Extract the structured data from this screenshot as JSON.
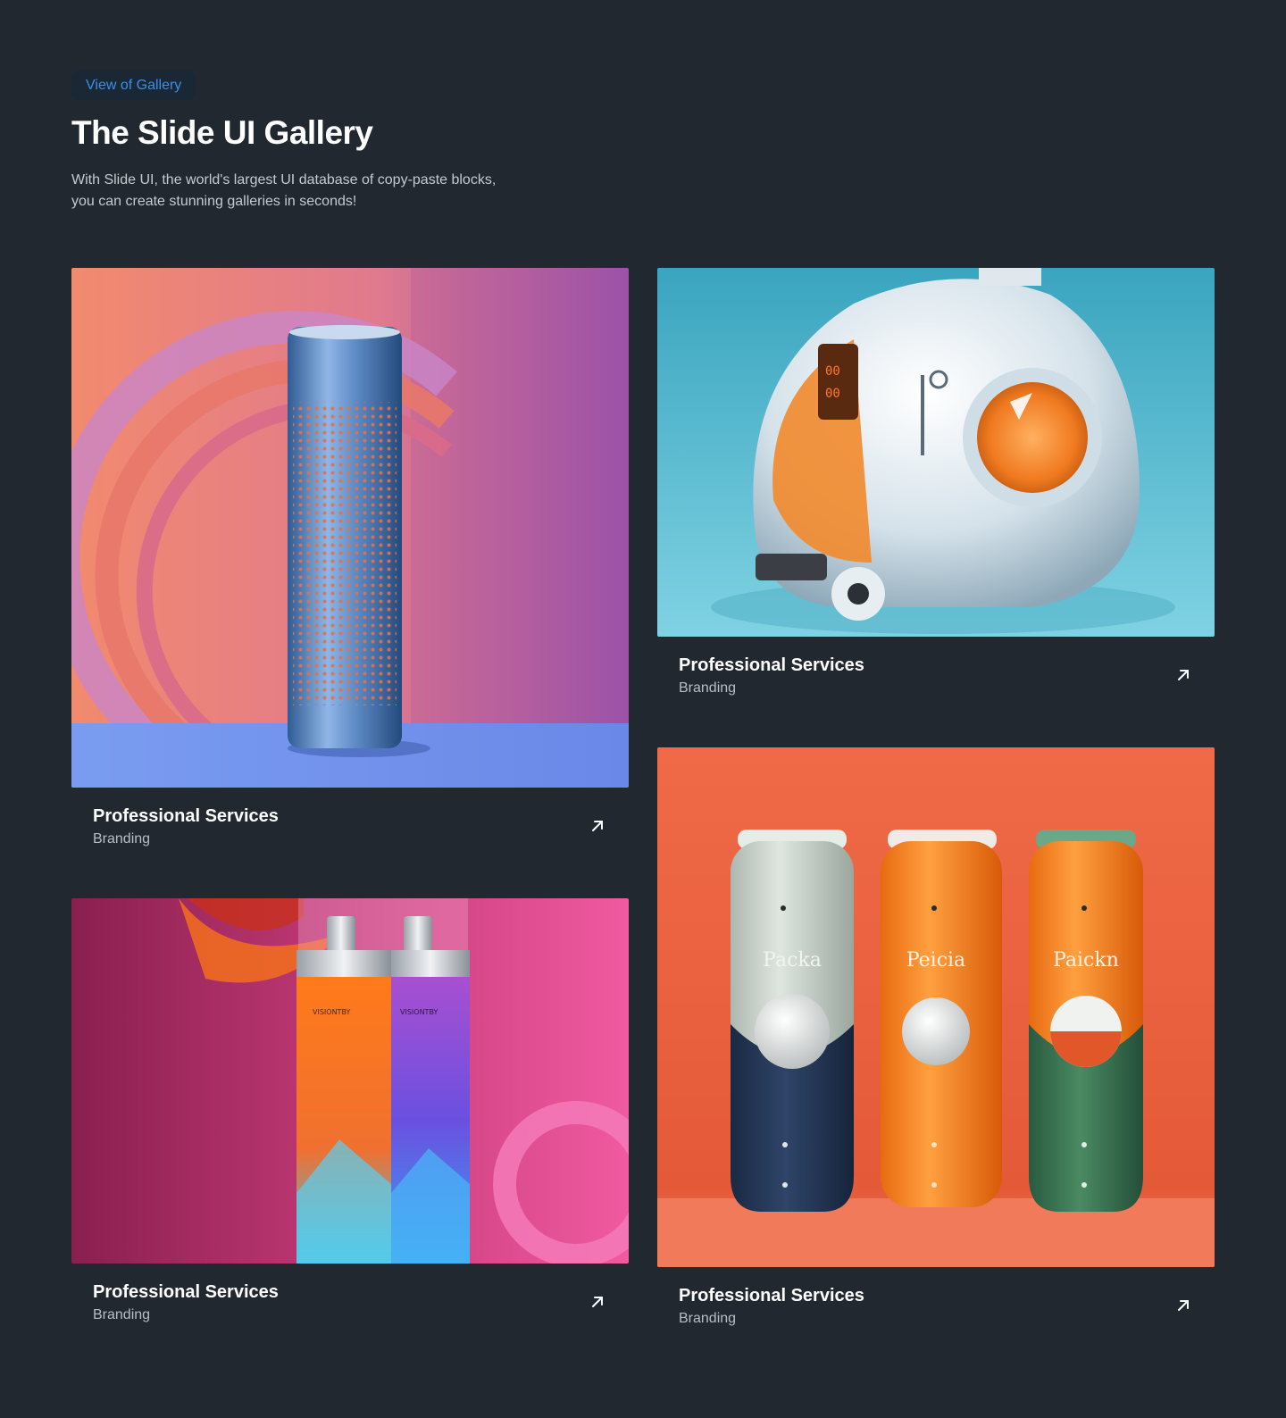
{
  "header": {
    "badge": "View of Gallery",
    "title": "The Slide UI Gallery",
    "subtitle": "With Slide UI, the world's largest UI database of copy-paste blocks, you can create stunning galleries in seconds!"
  },
  "cards": [
    {
      "title": "Professional Services",
      "category": "Branding",
      "image": "blue-speaker-cylinder",
      "icon": "arrow-up-right-icon"
    },
    {
      "title": "Professional Services",
      "category": "Branding",
      "image": "white-orange-robot",
      "icon": "arrow-up-right-icon"
    },
    {
      "title": "Professional Services",
      "category": "Branding",
      "image": "spray-bottles-pink",
      "icon": "arrow-up-right-icon"
    },
    {
      "title": "Professional Services",
      "category": "Branding",
      "image": "three-packaging-bottles",
      "icon": "arrow-up-right-icon"
    }
  ],
  "bottle_labels": [
    "Packa",
    "Peicia",
    "Paickn"
  ],
  "colors": {
    "background": "#22282f",
    "accent": "#3b8fe8"
  }
}
